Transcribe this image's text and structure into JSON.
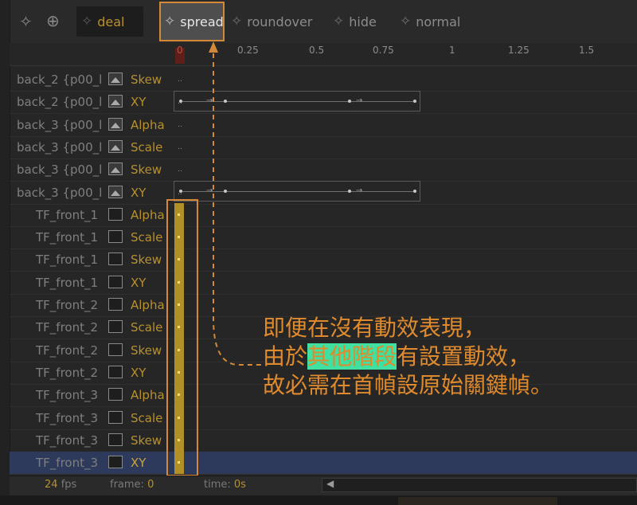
{
  "toolbar": {
    "tabs": [
      {
        "label": "deal"
      },
      {
        "label": "spread"
      },
      {
        "label": "roundover"
      },
      {
        "label": "hide"
      },
      {
        "label": "normal"
      }
    ]
  },
  "ruler": {
    "ticks": [
      "0",
      "0.25",
      "0.5",
      "0.75",
      "1",
      "1.25",
      "1.5"
    ]
  },
  "rows": [
    {
      "name": "back_2 {p00_l",
      "prop": "Skew"
    },
    {
      "name": "back_2 {p00_l",
      "prop": "XY"
    },
    {
      "name": "back_3 {p00_l",
      "prop": "Alpha"
    },
    {
      "name": "back_3 {p00_l",
      "prop": "Scale"
    },
    {
      "name": "back_3 {p00_l",
      "prop": "Skew"
    },
    {
      "name": "back_3 {p00_l",
      "prop": "XY"
    },
    {
      "name": "TF_front_1",
      "prop": "Alpha"
    },
    {
      "name": "TF_front_1",
      "prop": "Scale"
    },
    {
      "name": "TF_front_1",
      "prop": "Skew"
    },
    {
      "name": "TF_front_1",
      "prop": "XY"
    },
    {
      "name": "TF_front_2",
      "prop": "Alpha"
    },
    {
      "name": "TF_front_2",
      "prop": "Scale"
    },
    {
      "name": "TF_front_2",
      "prop": "Skew"
    },
    {
      "name": "TF_front_2",
      "prop": "XY"
    },
    {
      "name": "TF_front_3",
      "prop": "Alpha"
    },
    {
      "name": "TF_front_3",
      "prop": "Scale"
    },
    {
      "name": "TF_front_3",
      "prop": "Skew"
    },
    {
      "name": "TF_front_3",
      "prop": "XY"
    }
  ],
  "status": {
    "fps_value": "24",
    "fps_label": "fps",
    "frame_label": "frame:",
    "frame_value": "0",
    "time_label": "time:",
    "time_value": "0s"
  },
  "annotation": {
    "line1": "即便在沒有動效表現，",
    "line2_pre": "由於",
    "line2_highlight": "其他階段",
    "line2_post": "有設置動效，",
    "line3": "故必需在首幀設原始關鍵幀。"
  },
  "colors": {
    "accent_orange": "#d4893a",
    "property_gold": "#b8902e",
    "highlight_green": "#3fe0a0",
    "selected_row": "#2d3a5c"
  },
  "icons": {
    "add_layer": "plus-circle-icon",
    "tab_icon": "sparkle-icon"
  }
}
